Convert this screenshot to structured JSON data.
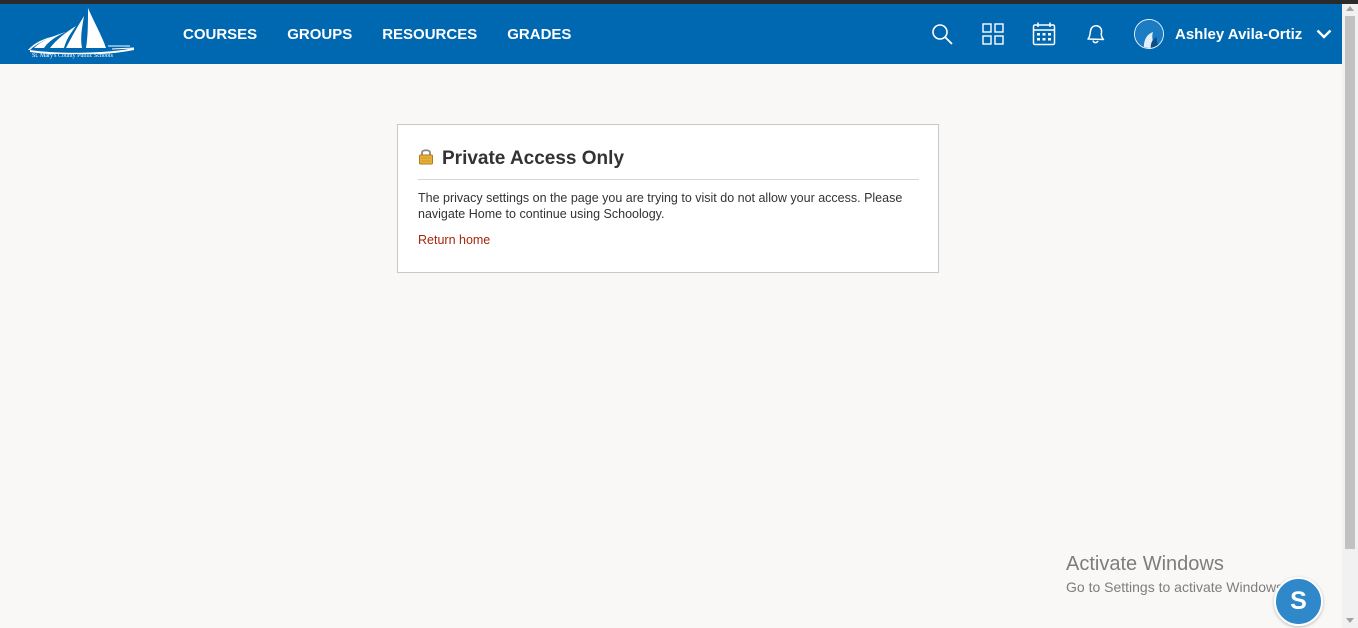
{
  "logo": {
    "school_name": "St. Mary's County Public Schools",
    "icon": "sailboat-logo-icon"
  },
  "nav": {
    "links": [
      "COURSES",
      "GROUPS",
      "RESOURCES",
      "GRADES"
    ],
    "icons": [
      "search-icon",
      "apps-grid-icon",
      "calendar-icon",
      "notifications-bell-icon"
    ]
  },
  "user": {
    "name": "Ashley Avila-Ortiz",
    "icon": "chevron-down-icon"
  },
  "card": {
    "title": "Private Access Only",
    "message": "The privacy settings on the page you are trying to visit do not allow your access. Please navigate Home to continue using Schoology.",
    "link": "Return home",
    "icon": "lock-icon"
  },
  "watermark": {
    "title": "Activate Windows",
    "subtitle": "Go to Settings to activate Windows."
  },
  "help_bubble": {
    "label": "S"
  },
  "colors": {
    "nav_bg": "#0067b1",
    "page_bg": "#f9f8f7",
    "link": "#a4270b"
  }
}
